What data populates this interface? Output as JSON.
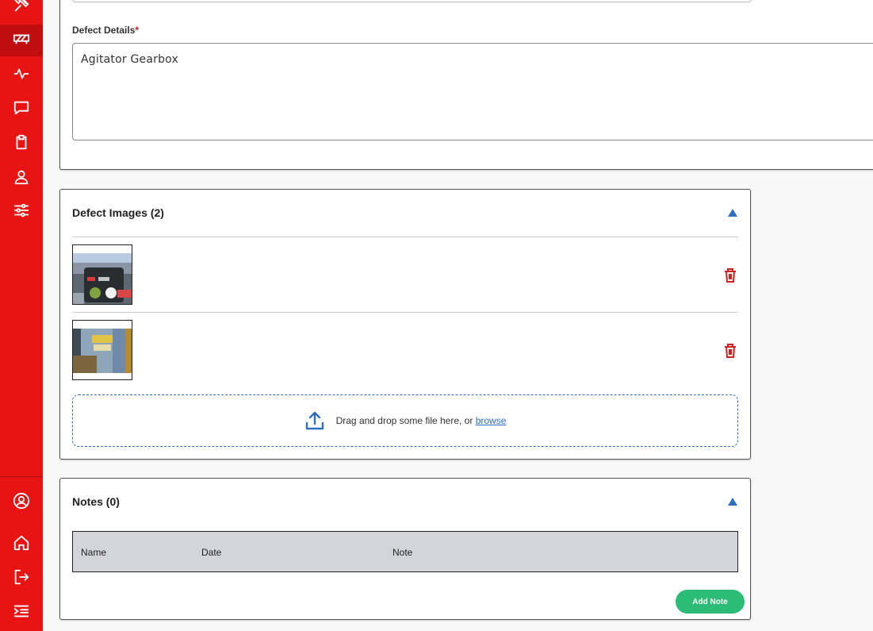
{
  "sidebar": {
    "top_items": [
      {
        "icon": "tools-icon"
      },
      {
        "icon": "barrier-icon",
        "active": true
      },
      {
        "icon": "activity-icon"
      },
      {
        "icon": "chat-icon"
      },
      {
        "icon": "clipboard-icon"
      },
      {
        "icon": "user-icon"
      },
      {
        "icon": "sliders-icon"
      }
    ],
    "bottom_items": [
      {
        "icon": "account-circle-icon"
      },
      {
        "icon": "home-icon"
      },
      {
        "icon": "logout-icon"
      },
      {
        "icon": "menu-collapse-icon"
      }
    ]
  },
  "defect_details": {
    "label": "Defect Details",
    "required_mark": "*",
    "value": "Agitator Gearbox"
  },
  "defect_images": {
    "title": "Defect Images (2)",
    "images": [
      {
        "alt_icon": "image-thumbnail"
      },
      {
        "alt_icon": "image-thumbnail"
      }
    ],
    "dropzone_text": "Drag and drop some file here, or",
    "dropzone_link": "browse"
  },
  "notes": {
    "title": "Notes (0)",
    "columns": [
      "Name",
      "Date",
      "Note"
    ],
    "add_button": "Add Note"
  },
  "colors": {
    "sidebar": "#e81414",
    "sidebar_active": "#c10d0d",
    "accent_blue": "#2f6fbd",
    "add_green": "#2cbc76",
    "delete_red": "#d21f1f"
  }
}
